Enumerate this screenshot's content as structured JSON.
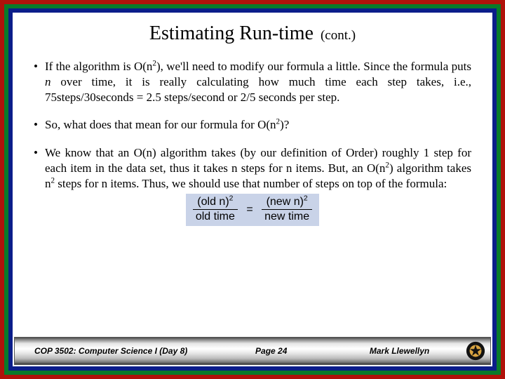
{
  "title": {
    "main": "Estimating Run-time",
    "suffix": "(cont.)"
  },
  "bullets": {
    "b1_pre": "If the algorithm is O(n",
    "b1_sup1": "2",
    "b1_mid1": "), we'll need to modify our formula a little. Since the formula puts ",
    "b1_ital": "n",
    "b1_mid2": " over time, it is really calculating how much time each step takes, i.e., 75steps/30seconds = 2.5 steps/second or 2/5 seconds per step.",
    "b2_pre": " So, what does that mean for our formula for O(n",
    "b2_sup": "2",
    "b2_post": ")?",
    "b3_pre": "We know that an O(n) algorithm takes (by our definition of Order) roughly 1 step for each item in the data set, thus it takes n steps for n items. But, an O(n",
    "b3_sup1": "2",
    "b3_mid": ") algorithm takes n",
    "b3_sup2": "2",
    "b3_post": " steps for n items. Thus, we should use that number of steps on top of the formula:"
  },
  "formula": {
    "old_n": "old n",
    "old_time": "old time",
    "new_n": "new n",
    "new_time": "new time",
    "exp": "2"
  },
  "footer": {
    "left": "COP 3502: Computer Science I (Day 8)",
    "mid": "Page 24",
    "right": "Mark Llewellyn"
  }
}
